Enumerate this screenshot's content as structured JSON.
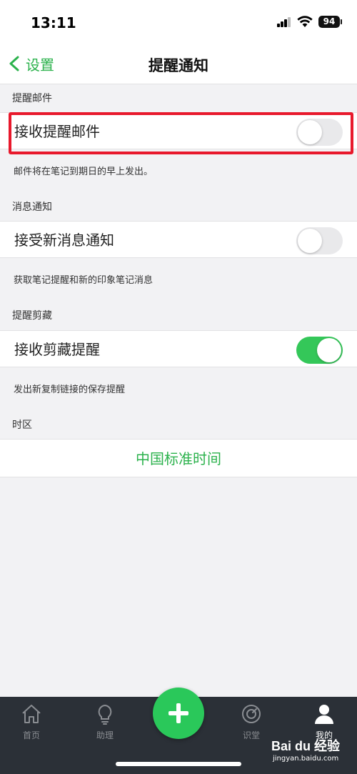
{
  "status_bar": {
    "time": "13:11",
    "battery": "94"
  },
  "nav": {
    "back_label": "设置",
    "title": "提醒通知"
  },
  "sections": [
    {
      "header": "提醒邮件",
      "row_label": "接收提醒邮件",
      "toggle_on": false,
      "footnote": "邮件将在笔记到期日的早上发出。",
      "highlighted": true
    },
    {
      "header": "消息通知",
      "row_label": "接受新消息通知",
      "toggle_on": false,
      "footnote": "获取笔记提醒和新的印象笔记消息"
    },
    {
      "header": "提醒剪藏",
      "row_label": "接收剪藏提醒",
      "toggle_on": true,
      "footnote": "发出新复制链接的保存提醒"
    }
  ],
  "timezone": {
    "header": "时区",
    "value": "中国标准时间"
  },
  "tab_bar": {
    "items": [
      {
        "label": "首页",
        "icon": "home-icon",
        "active": false
      },
      {
        "label": "助理",
        "icon": "lightbulb-icon",
        "active": false
      },
      {
        "label": "识堂",
        "icon": "compass-icon",
        "active": false
      },
      {
        "label": "我的",
        "icon": "person-icon",
        "active": true
      }
    ],
    "fab_icon": "plus-icon"
  },
  "watermark": {
    "logo": "Bai du 经验",
    "url": "jingyan.baidu.com"
  },
  "colors": {
    "accent_green": "#2bb24c",
    "toggle_on": "#34c759",
    "highlight_red": "#e8192c",
    "tab_bar_bg": "#2b3037"
  }
}
